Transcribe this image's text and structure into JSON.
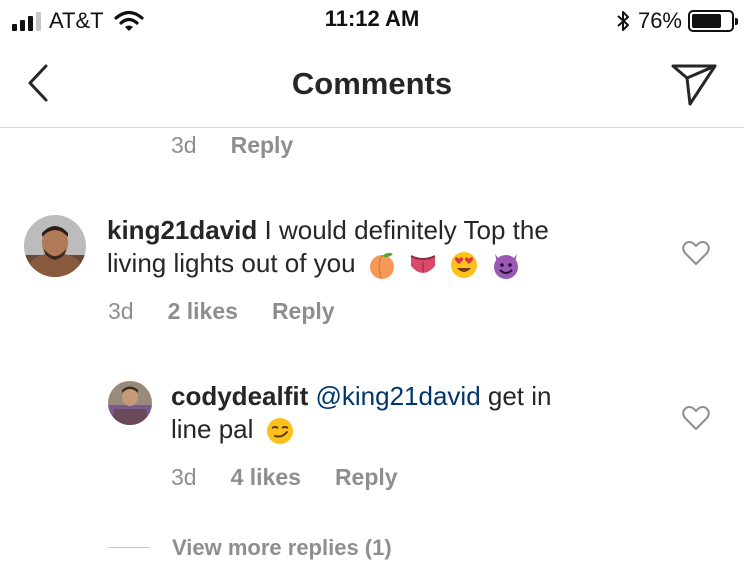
{
  "status_bar": {
    "carrier": "AT&T",
    "time": "11:12 AM",
    "battery_percent": "76%",
    "battery_level": 0.76,
    "signal_bars_filled": 3,
    "signal_bars_total": 4
  },
  "nav": {
    "title": "Comments",
    "back_icon": "chevron-left-icon",
    "send_icon": "direct-message-icon"
  },
  "top_comment_meta": {
    "time": "3d",
    "reply": "Reply"
  },
  "comments": [
    {
      "username": "king21david",
      "text_line1": "I would definitely Top the",
      "text_line2": "living lights out of you",
      "emojis": [
        "peach",
        "tongue",
        "heart-eyes",
        "smiling-devil"
      ],
      "time": "3d",
      "likes": "2 likes",
      "reply": "Reply"
    },
    {
      "username": "codydealfit",
      "mention": "@king21david",
      "text_tail": "get in",
      "text_line2": "line pal",
      "emojis": [
        "smirk"
      ],
      "time": "3d",
      "likes": "4 likes",
      "reply": "Reply"
    }
  ],
  "view_more": "View more replies (1)",
  "colors": {
    "text": "#262626",
    "secondary": "#8e8e8e",
    "mention": "#00376b",
    "divider": "#dbdbdb"
  }
}
